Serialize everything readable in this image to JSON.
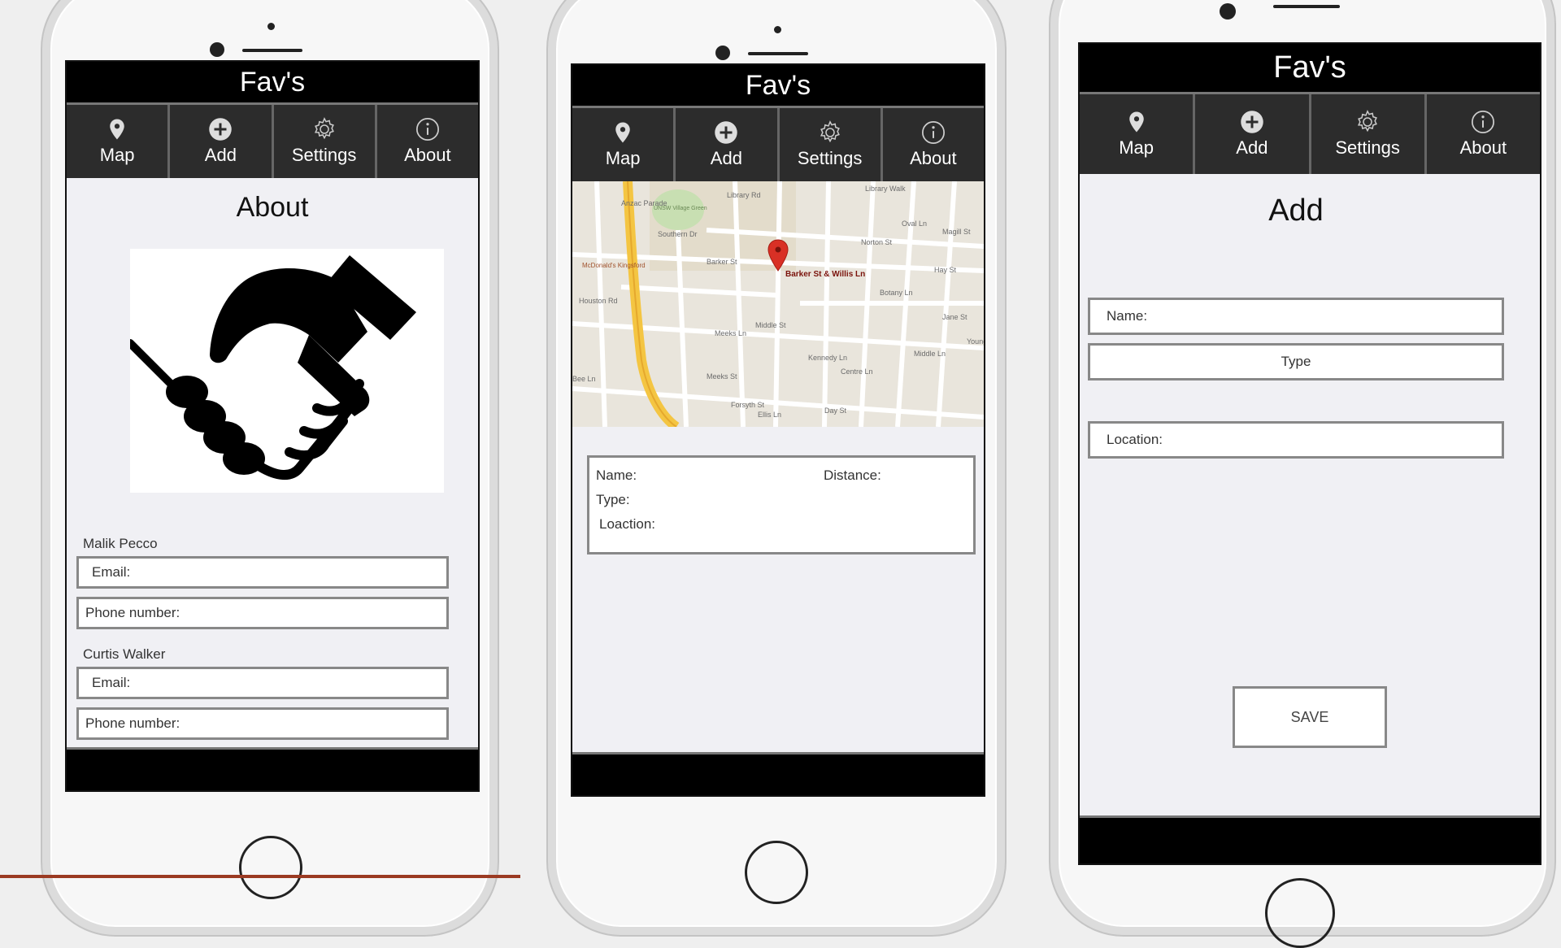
{
  "app": {
    "title": "Fav's"
  },
  "nav": [
    {
      "label": "Map",
      "icon": "map-pin-icon"
    },
    {
      "label": "Add",
      "icon": "plus-circle-icon"
    },
    {
      "label": "Settings",
      "icon": "gear-icon"
    },
    {
      "label": "About",
      "icon": "info-icon"
    }
  ],
  "about": {
    "heading": "About",
    "image_icon": "handshake-icon",
    "contacts": [
      {
        "name": "Malik Pecco",
        "email_placeholder": "Email:",
        "phone_placeholder": "Phone number:"
      },
      {
        "name": "Curtis Walker",
        "email_placeholder": "Email:",
        "phone_placeholder": "Phone number:"
      }
    ]
  },
  "map": {
    "marker_label": "Barker St & Willis Ln",
    "streets": [
      "Library Rd",
      "Library Walk",
      "UNSW Village Green",
      "Southern Dr",
      "Oval Ln",
      "Magill St",
      "Barker St",
      "Norton St",
      "Hay St",
      "McDonald's Kingsford",
      "Houston Rd",
      "Anzac Parade",
      "Middle St",
      "Meeks St",
      "Kennedy Ln",
      "Centre Ln",
      "Botany Ln",
      "Jane St",
      "Middle Ln",
      "Meeks Ln",
      "Bee Ln",
      "Forsyth St",
      "Ellis Ln",
      "Day St",
      "Young St"
    ],
    "info": {
      "name_label": "Name:",
      "distance_label": "Distance:",
      "type_label": "Type:",
      "location_label": "Loaction:"
    }
  },
  "add": {
    "heading": "Add",
    "name_placeholder": "Name:",
    "type_placeholder": "Type",
    "location_placeholder": "Location:",
    "save_label": "SAVE"
  }
}
